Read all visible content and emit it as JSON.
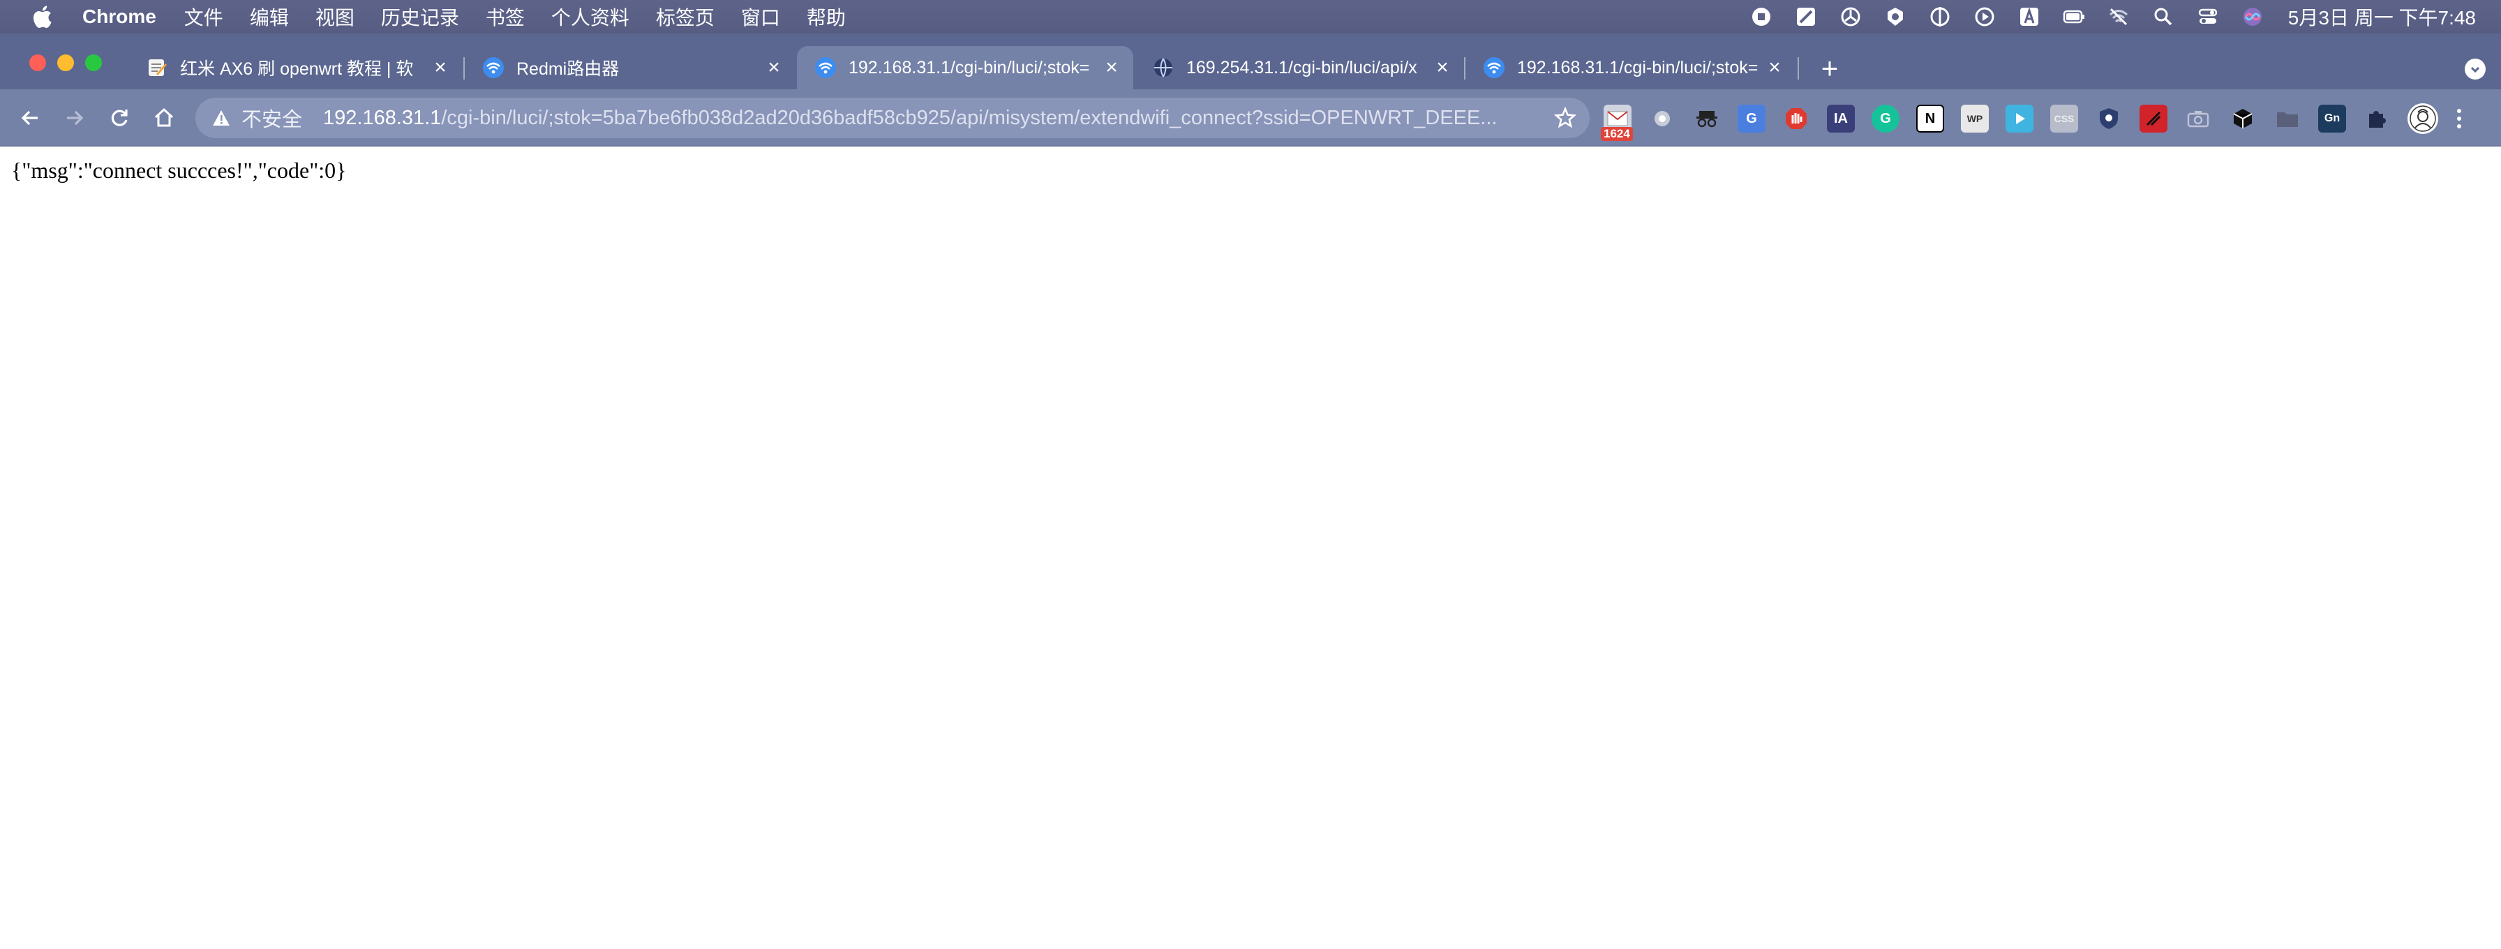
{
  "menubar": {
    "app_name": "Chrome",
    "items": [
      "文件",
      "编辑",
      "视图",
      "历史记录",
      "书签",
      "个人资料",
      "标签页",
      "窗口",
      "帮助"
    ],
    "clock": "5月3日 周一 下午7:48",
    "tray_icons": [
      "stop-circle-icon",
      "pen-icon",
      "hexagon-app-icon",
      "shield-icon",
      "tuning-fork-icon",
      "play-circle-icon",
      "input-method-icon",
      "battery-icon",
      "wifi-off-icon",
      "search-icon",
      "control-center-icon",
      "siri-icon"
    ]
  },
  "tabs": [
    {
      "title": "红米 AX6 刷 openwrt 教程 | 软",
      "favicon": "notes-icon",
      "active": false
    },
    {
      "title": "Redmi路由器",
      "favicon": "wifi-icon",
      "active": false
    },
    {
      "title": "192.168.31.1/cgi-bin/luci/;stok=",
      "favicon": "wifi-icon",
      "active": true
    },
    {
      "title": "169.254.31.1/cgi-bin/luci/api/x",
      "favicon": "globe-icon",
      "active": false
    },
    {
      "title": "192.168.31.1/cgi-bin/luci/;stok=",
      "favicon": "wifi-icon",
      "active": false
    }
  ],
  "toolbar": {
    "insecure_label": "不安全",
    "url_host": "192.168.31.1",
    "url_path": "/cgi-bin/luci/;stok=5ba7be6fb038d2ad20d36badf58cb925/api/misystem/extendwifi_connect?ssid=OPENWRT_DEEE...",
    "extension_badge": "1624"
  },
  "page": {
    "body_text": "{\"msg\":\"connect succces!\",\"code\":0}"
  },
  "colors": {
    "menubar": "#5a6086",
    "tabstrip": "#5b6790",
    "toolbar": "#7582a8",
    "omnibox": "#8894b8"
  }
}
